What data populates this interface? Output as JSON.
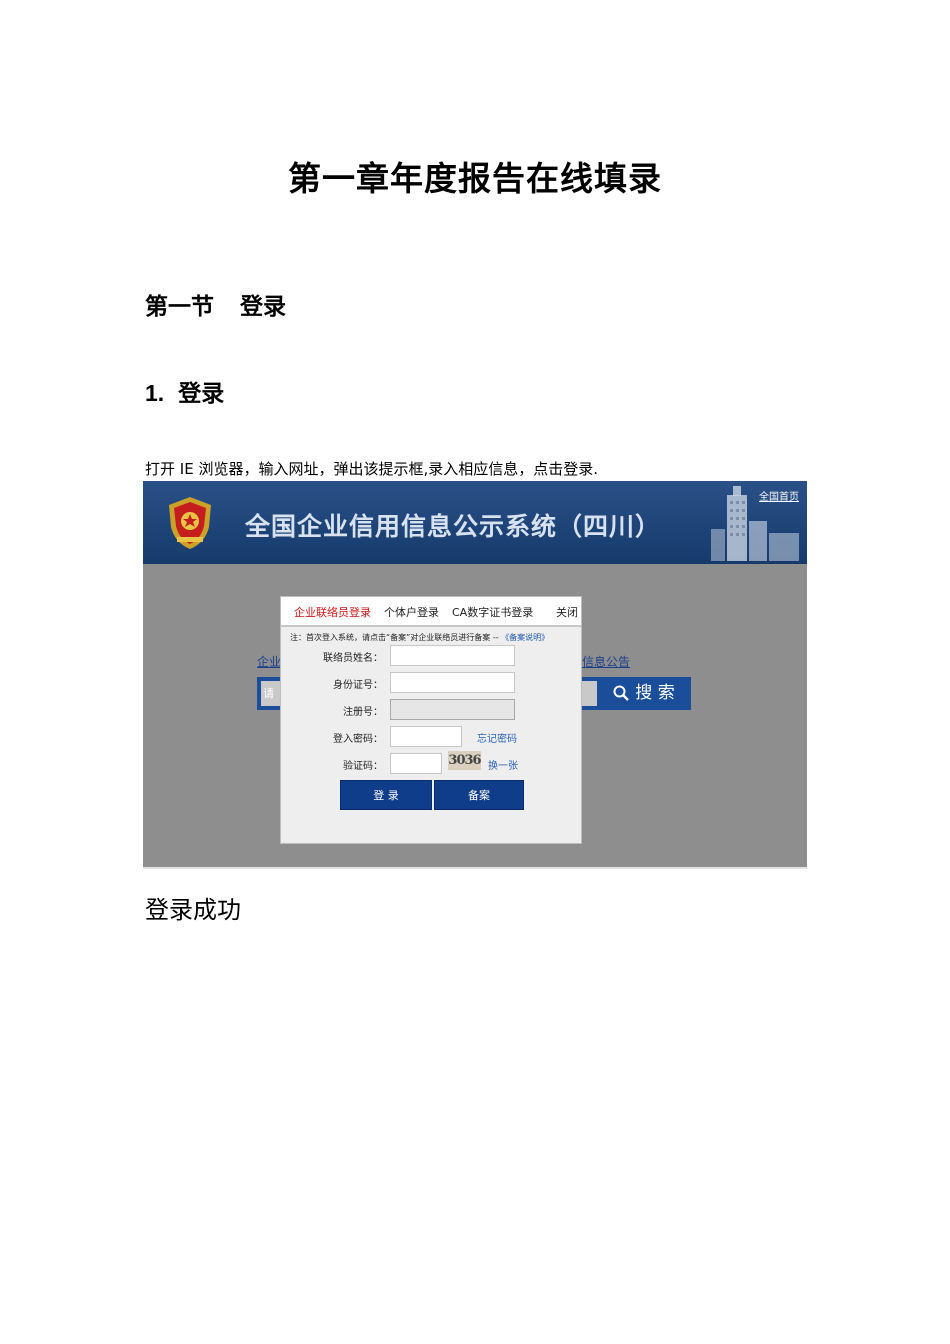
{
  "document": {
    "title": "第一章年度报告在线填录",
    "section_heading": {
      "part1": "第一节",
      "part2": "登录"
    },
    "sub_heading": {
      "number": "1.",
      "text": "登录"
    },
    "instruction": "打开 IE 浏览器，输入网址，弹出该提示框,录入相应信息，点击登录.",
    "success_text": "登录成功"
  },
  "screenshot": {
    "banner": {
      "system_title": "全国企业信用信息公示系统（四川）",
      "home_link": "全国首页"
    },
    "background": {
      "left_link": "企业",
      "right_link": "信息公告",
      "search_placeholder": "请输",
      "search_button": "搜 索"
    },
    "login_modal": {
      "tabs": [
        {
          "label": "企业联络员登录",
          "active": true
        },
        {
          "label": "个体户登录",
          "active": false
        },
        {
          "label": "CA数字证书登录",
          "active": false
        }
      ],
      "close_label": "关闭",
      "notice_prefix": "注：首次登入系统，请点击“备案”对企业联络员进行备案 --",
      "notice_link": "《备案说明》",
      "fields": {
        "contact_name": {
          "label": "联络员姓名：",
          "value": ""
        },
        "id_number": {
          "label": "身份证号：",
          "value": ""
        },
        "reg_number": {
          "label": "注册号：",
          "value": ""
        },
        "password": {
          "label": "登入密码：",
          "value": ""
        },
        "captcha": {
          "label": "验证码：",
          "value": ""
        }
      },
      "forgot_password": "忘记密码",
      "captcha_image_text": "3036",
      "refresh_captcha": "换一张",
      "login_button": "登 录",
      "register_button": "备案"
    }
  },
  "colors": {
    "banner_blue": "#1e4478",
    "button_blue": "#103d8a",
    "active_tab_red": "#d01818",
    "link_blue": "#2a62b8",
    "screenshot_bg_gray": "#8e8e8e"
  }
}
